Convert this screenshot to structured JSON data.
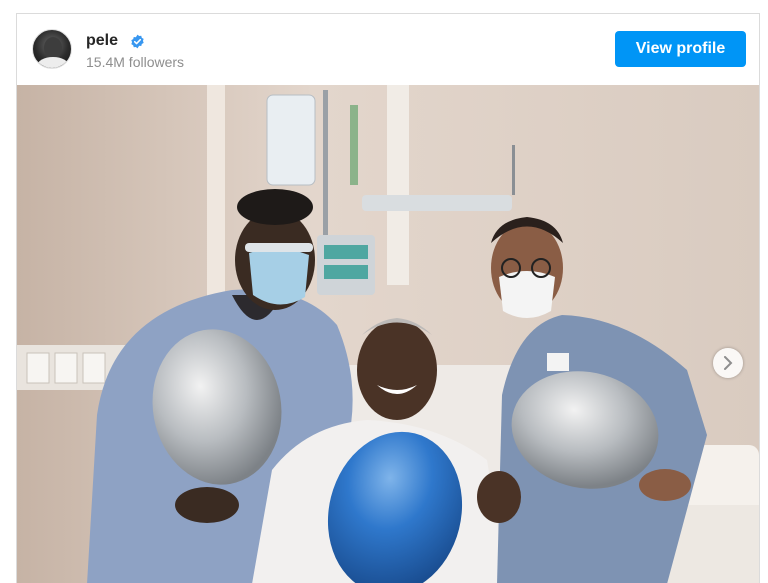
{
  "post": {
    "username": "pele",
    "verified": true,
    "followers": "15.4M followers",
    "view_profile_label": "View profile"
  },
  "icons": {
    "verified": "verified-badge-icon",
    "next": "chevron-right-icon"
  },
  "colors": {
    "accent": "#0095f6",
    "verified": "#3897f0",
    "secondary_text": "#8e8e8e"
  }
}
